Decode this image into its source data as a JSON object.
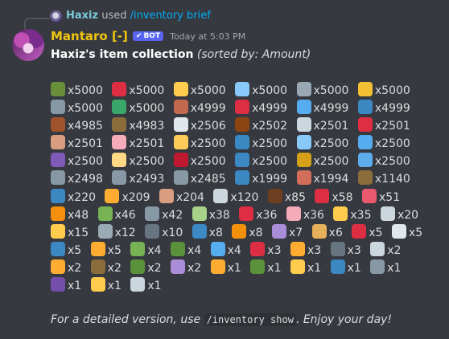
{
  "reply": {
    "user": "Haxiz",
    "used": "used",
    "command": "/inventory brief"
  },
  "message": {
    "username": "Mantaro [-]",
    "badge": "BOT",
    "timestamp": "Today at 5:03 PM",
    "title_bold": "Haxiz's item collection",
    "title_sort": "(sorted by: Amount)",
    "footer_pre": "For a detailed version, use",
    "footer_cmd": "/inventory show",
    "footer_post": ". Enjoy your day!"
  },
  "items": [
    {
      "icon": "champagne-icon",
      "color": "#6a8f3a",
      "amount": "x5000"
    },
    {
      "icon": "ticket-icon",
      "color": "#dd2e44",
      "amount": "x5000"
    },
    {
      "icon": "house-icon",
      "color": "#ffcc4d",
      "amount": "x5000"
    },
    {
      "icon": "sake-icon",
      "color": "#88c9f9",
      "amount": "x5000"
    },
    {
      "icon": "syringe-icon",
      "color": "#99aab5",
      "amount": "x5000"
    },
    {
      "icon": "pill-icon",
      "color": "#f4c033",
      "amount": "x5000"
    },
    {
      "icon": "wrench-icon",
      "color": "#8899a6",
      "amount": "x5000"
    },
    {
      "icon": "motorcycle-icon",
      "color": "#3aa66a",
      "amount": "x5000"
    },
    {
      "icon": "key-icon",
      "color": "#c1694f",
      "amount": "x4999"
    },
    {
      "icon": "car-icon",
      "color": "#dd2e44",
      "amount": "x4999"
    },
    {
      "icon": "cup-icon",
      "color": "#55acee",
      "amount": "x4999"
    },
    {
      "icon": "fishing-icon",
      "color": "#3b88c3",
      "amount": "x4999"
    },
    {
      "icon": "crate-icon",
      "color": "#a0522d",
      "amount": "x4985"
    },
    {
      "icon": "pickaxe-icon",
      "color": "#8a6d3b",
      "amount": "x4983"
    },
    {
      "icon": "milk-icon",
      "color": "#e1e8ed",
      "amount": "x2506"
    },
    {
      "icon": "chocolate-icon",
      "color": "#8b4513",
      "amount": "x2502"
    },
    {
      "icon": "newspaper-icon",
      "color": "#ccd6dd",
      "amount": "x2501"
    },
    {
      "icon": "shoe-icon",
      "color": "#dd2e44",
      "amount": "x2501"
    },
    {
      "icon": "cookie-icon",
      "color": "#d99e82",
      "amount": "x2501"
    },
    {
      "icon": "cake-icon",
      "color": "#f4abba",
      "amount": "x2501"
    },
    {
      "icon": "moneybag-icon",
      "color": "#fdcb58",
      "amount": "x2500"
    },
    {
      "icon": "shirt-icon",
      "color": "#3b88c3",
      "amount": "x2500"
    },
    {
      "icon": "diamond-icon",
      "color": "#88c9f9",
      "amount": "x2500"
    },
    {
      "icon": "dress-icon",
      "color": "#55acee",
      "amount": "x2500"
    },
    {
      "icon": "ring-icon",
      "color": "#7f5ab6",
      "amount": "x2500"
    },
    {
      "icon": "bulb-icon",
      "color": "#ffd983",
      "amount": "x2500"
    },
    {
      "icon": "rose-icon",
      "color": "#be1931",
      "amount": "x2500"
    },
    {
      "icon": "jeans-icon",
      "color": "#3b88c3",
      "amount": "x2500"
    },
    {
      "icon": "broom-icon",
      "color": "#d4a017",
      "amount": "x2500"
    },
    {
      "icon": "laptop-icon",
      "color": "#5dadec",
      "amount": "x2500"
    },
    {
      "icon": "wave-icon",
      "color": "#8899a6",
      "amount": "x2498"
    },
    {
      "icon": "axe-icon",
      "color": "#8899a6",
      "amount": "x2493"
    },
    {
      "icon": "hammer-icon",
      "color": "#8899a6",
      "amount": "x2485"
    },
    {
      "icon": "pipe-icon",
      "color": "#3b88c3",
      "amount": "x1999"
    },
    {
      "icon": "steak-icon",
      "color": "#d36e5a",
      "amount": "x1994"
    },
    {
      "icon": "pick-icon",
      "color": "#8a6d3b",
      "amount": "x1140"
    },
    {
      "icon": "fish-icon",
      "color": "#3b88c3",
      "amount": "x220"
    },
    {
      "icon": "tropical-fish-icon",
      "color": "#ffac33",
      "amount": "x209"
    },
    {
      "icon": "pufferfish-icon",
      "color": "#d99e82",
      "amount": "x204"
    },
    {
      "icon": "floppy-icon",
      "color": "#ccd6dd",
      "amount": "x120"
    },
    {
      "icon": "wood-icon",
      "color": "#6d3e1f",
      "amount": "x85"
    },
    {
      "icon": "crab-icon",
      "color": "#dd2e44",
      "amount": "x58"
    },
    {
      "icon": "squid-icon",
      "color": "#ea596e",
      "amount": "x51"
    },
    {
      "icon": "shrimp-icon",
      "color": "#f4900c",
      "amount": "x48"
    },
    {
      "icon": "leaf-icon",
      "color": "#77b255",
      "amount": "x46"
    },
    {
      "icon": "music-icon",
      "color": "#8899a6",
      "amount": "x42"
    },
    {
      "icon": "pear-icon",
      "color": "#a6d388",
      "amount": "x38"
    },
    {
      "icon": "apple-icon",
      "color": "#dd2e44",
      "amount": "x36"
    },
    {
      "icon": "blossom-icon",
      "color": "#f4abba",
      "amount": "x36"
    },
    {
      "icon": "moon-icon",
      "color": "#ffcc4d",
      "amount": "x35"
    },
    {
      "icon": "shell-icon",
      "color": "#ccd6dd",
      "amount": "x20"
    },
    {
      "icon": "pencil-icon",
      "color": "#ffcc4d",
      "amount": "x15"
    },
    {
      "icon": "web-icon",
      "color": "#99aab5",
      "amount": "x12"
    },
    {
      "icon": "shark-icon",
      "color": "#66757f",
      "amount": "x10"
    },
    {
      "icon": "fishing-rod-icon",
      "color": "#3b88c3",
      "amount": "x8"
    },
    {
      "icon": "pizza-icon",
      "color": "#f4900c",
      "amount": "x8"
    },
    {
      "icon": "star-gem-icon",
      "color": "#aa8dd8",
      "amount": "x7"
    },
    {
      "icon": "bread-icon",
      "color": "#e6b05a",
      "amount": "x6"
    },
    {
      "icon": "lollipop-icon",
      "color": "#dd2e44",
      "amount": "x5"
    },
    {
      "icon": "love-letter-icon",
      "color": "#e1e8ed",
      "amount": "x5"
    },
    {
      "icon": "rod-icon",
      "color": "#3b88c3",
      "amount": "x5"
    },
    {
      "icon": "sparkles-icon",
      "color": "#ffac33",
      "amount": "x5"
    },
    {
      "icon": "tree-icon",
      "color": "#77b255",
      "amount": "x4"
    },
    {
      "icon": "gem-icon",
      "color": "#5c913b",
      "amount": "x4"
    },
    {
      "icon": "rod-blue-icon",
      "color": "#55acee",
      "amount": "x4"
    },
    {
      "icon": "die-icon",
      "color": "#dd2e44",
      "amount": "x3"
    },
    {
      "icon": "bell-icon",
      "color": "#ffac33",
      "amount": "x3"
    },
    {
      "icon": "shrine-icon",
      "color": "#66757f",
      "amount": "x3"
    },
    {
      "icon": "memo-icon",
      "color": "#ccd6dd",
      "amount": "x2"
    },
    {
      "icon": "sun-icon",
      "color": "#ffac33",
      "amount": "x2"
    },
    {
      "icon": "pickaxe2-icon",
      "color": "#8a6d3b",
      "amount": "x2"
    },
    {
      "icon": "pickaxe3-icon",
      "color": "#5c913b",
      "amount": "x2"
    },
    {
      "icon": "rod-purple-icon",
      "color": "#aa8dd8",
      "amount": "x2"
    },
    {
      "icon": "star-icon",
      "color": "#ffac33",
      "amount": "x1"
    },
    {
      "icon": "chest-icon",
      "color": "#5c913b",
      "amount": "x1"
    },
    {
      "icon": "rod-gold-icon",
      "color": "#ffcc4d",
      "amount": "x1"
    },
    {
      "icon": "rod-teal-icon",
      "color": "#3b88c3",
      "amount": "x1"
    },
    {
      "icon": "pickaxe4-icon",
      "color": "#8899a6",
      "amount": "x1"
    },
    {
      "icon": "rod-violet-icon",
      "color": "#744eaa",
      "amount": "x1"
    },
    {
      "icon": "rod-yellow-icon",
      "color": "#ffcc4d",
      "amount": "x1"
    },
    {
      "icon": "salt-icon",
      "color": "#ccd6dd",
      "amount": "x1"
    }
  ]
}
